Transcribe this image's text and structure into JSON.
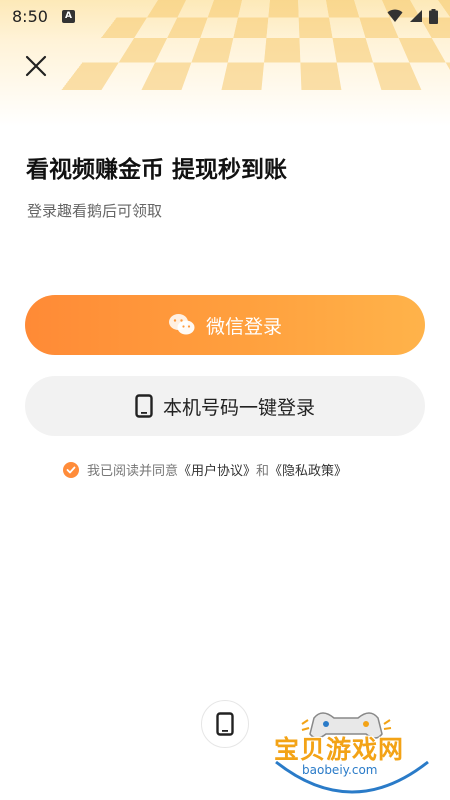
{
  "status_bar": {
    "time": "8:50",
    "notification_badge": "A",
    "icons": [
      "wifi-icon",
      "signal-icon",
      "battery-icon"
    ]
  },
  "headline": "看视频赚金币 提现秒到账",
  "subline": "登录趣看鹅后可领取",
  "wechat_login_label": "微信登录",
  "phone_login_label": "本机号码一键登录",
  "agreement": {
    "prefix": "我已阅读并同意",
    "user_agreement": "《用户协议》",
    "conjunction": "和",
    "privacy_policy": "《隐私政策》",
    "checked": true
  },
  "watermark": {
    "name": "宝贝游戏网",
    "url": "baobeiy.com"
  },
  "colors": {
    "accent_start": "#ff8a36",
    "accent_end": "#ffb34a",
    "secondary_button": "#f2f2f2"
  }
}
